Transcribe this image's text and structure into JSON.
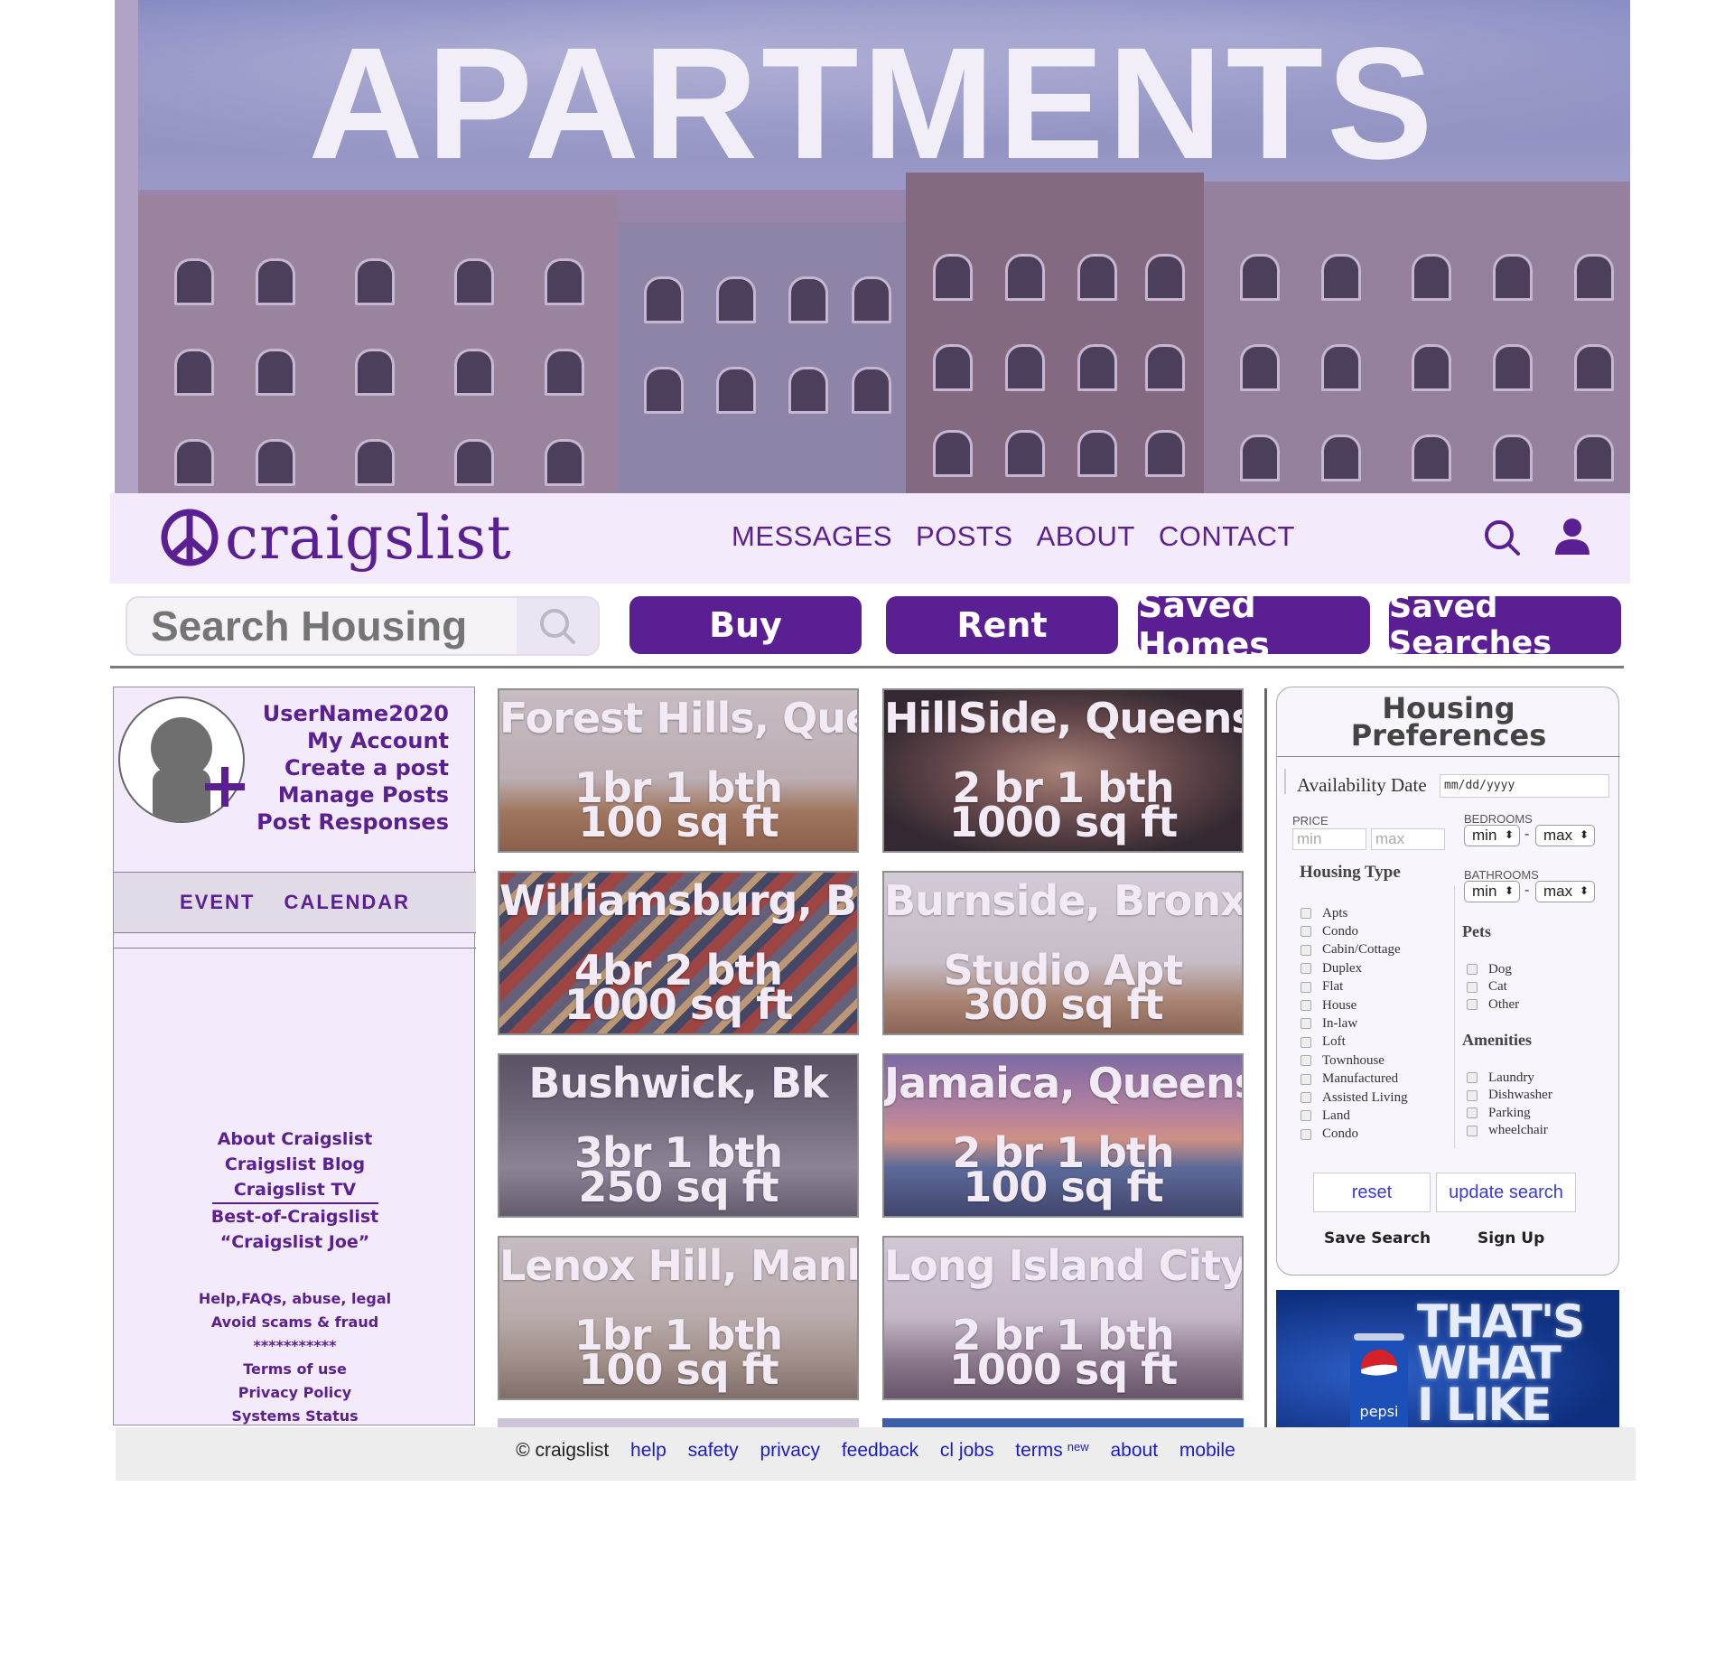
{
  "hero": {
    "title": "APARTMENTS"
  },
  "nav": {
    "brand": "craigslist",
    "links": [
      "MESSAGES",
      "POSTS",
      "ABOUT",
      "CONTACT"
    ]
  },
  "search": {
    "placeholder": "Search Housing",
    "buttons": {
      "buy": "Buy",
      "rent": "Rent",
      "saved_homes": "Saved Homes",
      "saved_searches": "Saved Searches"
    }
  },
  "sidebar": {
    "account_links": [
      "UserName2020",
      "My Account",
      "Create a post",
      "Manage Posts",
      "Post Responses"
    ],
    "event_calendar": "EVENT  CALENDAR",
    "footer_links_top": [
      "About Craigslist",
      "Craigslist Blog",
      "Craigslist TV",
      "Best-of-Craigslist",
      "“Craigslist Joe”"
    ],
    "footer_links_bottom": [
      "Help,FAQs, abuse, legal",
      "Avoid scams & fraud",
      "***********",
      "Terms of use",
      "Privacy Policy",
      "Systems Status"
    ]
  },
  "listings": [
    {
      "title": "Forest Hills, Queens",
      "line1": "1br 1 bth",
      "line2": "100 sq ft"
    },
    {
      "title": "HillSide, Queens",
      "line1": "2 br 1 bth",
      "line2": "1000 sq ft"
    },
    {
      "title": "Williamsburg, Bk",
      "line1": "4br 2 bth",
      "line2": "1000 sq ft"
    },
    {
      "title": "Burnside, Bronx",
      "line1": "Studio Apt",
      "line2": "300 sq ft"
    },
    {
      "title": "Bushwick, Bk",
      "line1": "3br 1 bth",
      "line2": "250 sq ft"
    },
    {
      "title": "Jamaica, Queens",
      "line1": "2 br 1 bth",
      "line2": "100 sq ft"
    },
    {
      "title": "Lenox Hill, Manh.",
      "line1": "1br 1 bth",
      "line2": "100 sq ft"
    },
    {
      "title": "Long Island City, Qu",
      "line1": "2 br 1 bth",
      "line2": "1000 sq ft"
    }
  ],
  "prefs": {
    "title_line1": "Housing",
    "title_line2": "Preferences",
    "availability_label": "Availability Date",
    "availability_placeholder": "mm/dd/yyyy",
    "price_label": "PRICE",
    "price_min": "min",
    "price_max": "max",
    "bedrooms_label": "BEDROOMS",
    "bathrooms_label": "BATHROOMS",
    "sel_min": "min",
    "sel_max": "max",
    "dash": "-",
    "housing_type_label": "Housing Type",
    "housing_types": [
      "Apts",
      "Condo",
      "Cabin/Cottage",
      "Duplex",
      "Flat",
      "House",
      "In-law",
      "Loft",
      "Townhouse",
      "Manufactured",
      "Assisted Living",
      "Land",
      "Condo"
    ],
    "pets_label": "Pets",
    "pets": [
      "Dog",
      "Cat",
      "Other"
    ],
    "amenities_label": "Amenities",
    "amenities": [
      "Laundry",
      "Dishwasher",
      "Parking",
      "wheelchair"
    ],
    "reset": "reset",
    "update": "update search",
    "save_search": "Save Search",
    "sign_up": "Sign Up"
  },
  "ad": {
    "brand": "pepsi",
    "text_line1": "THAT'S",
    "text_line2": "WHAT",
    "text_line3": "I LIKE"
  },
  "footer": {
    "copyright": "© craigslist",
    "links": [
      "help",
      "safety",
      "privacy",
      "feedback",
      "cl jobs",
      "terms",
      "about",
      "mobile"
    ],
    "new_badge": "new"
  },
  "colors": {
    "brand_purple": "#5b1f94",
    "nav_bg": "#f3ebfb",
    "link_blue": "#1a1ac8"
  }
}
